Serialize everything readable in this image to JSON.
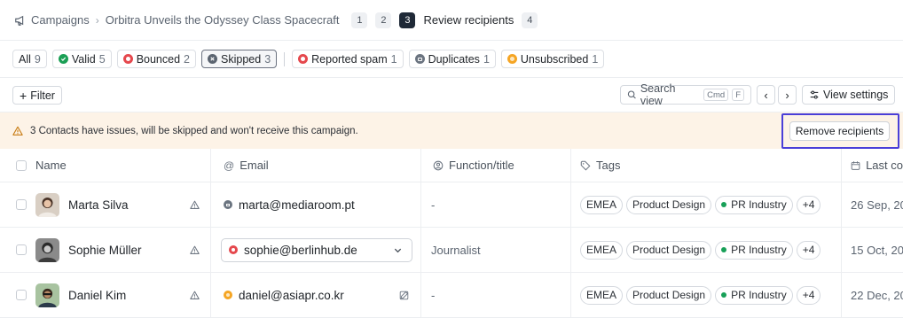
{
  "breadcrumb": {
    "campaigns": "Campaigns",
    "campaign_name": "Orbitra Unveils the Odyssey Class Spacecraft",
    "steps": [
      {
        "num": "1",
        "label": ""
      },
      {
        "num": "2",
        "label": ""
      },
      {
        "num": "3",
        "label": "Review recipients"
      },
      {
        "num": "4",
        "label": ""
      }
    ]
  },
  "filters": [
    {
      "label": "All",
      "count": "9",
      "icon": "none"
    },
    {
      "label": "Valid",
      "count": "5",
      "icon": "check-circle-icon",
      "color": "#1a9f55"
    },
    {
      "label": "Bounced",
      "count": "2",
      "icon": "bounce-icon",
      "color": "#e5484d"
    },
    {
      "label": "Skipped",
      "count": "3",
      "icon": "x-circle-icon",
      "color": "#5b6470"
    },
    {
      "label": "Reported spam",
      "count": "1",
      "icon": "spam-icon",
      "color": "#e5484d"
    },
    {
      "label": "Duplicates",
      "count": "1",
      "icon": "duplicate-icon",
      "color": "#6b7480"
    },
    {
      "label": "Unsubscribed",
      "count": "1",
      "icon": "unsubscribe-icon",
      "color": "#f5a524"
    }
  ],
  "toolbar": {
    "filter_label": "Filter",
    "search_placeholder": "Search view",
    "kbd_cmd": "Cmd",
    "kbd_f": "F",
    "view_settings": "View settings"
  },
  "banner": {
    "message": "3 Contacts have issues, will be skipped and won't receive this campaign.",
    "remove_label": "Remove recipients"
  },
  "table": {
    "headers": {
      "name": "Name",
      "email": "Email",
      "function": "Function/title",
      "tags": "Tags",
      "last": "Last co"
    },
    "rows": [
      {
        "name": "Marta Silva",
        "email": "marta@mediaroom.pt",
        "email_status": "duplicate",
        "function": "-",
        "tags": [
          "EMEA",
          "Product Design",
          "PR Industry"
        ],
        "more_tags": "+4",
        "last": "26 Sep, 20"
      },
      {
        "name": "Sophie Müller",
        "email": "sophie@berlinhub.de",
        "email_status": "bounced",
        "function": "Journalist",
        "tags": [
          "EMEA",
          "Product Design",
          "PR Industry"
        ],
        "more_tags": "+4",
        "last": "15 Oct, 20"
      },
      {
        "name": "Daniel Kim",
        "email": "daniel@asiapr.co.kr",
        "email_status": "unsubscribed",
        "function": "-",
        "tags": [
          "EMEA",
          "Product Design",
          "PR Industry"
        ],
        "more_tags": "+4",
        "last": "22 Dec, 20"
      }
    ]
  },
  "colors": {
    "accent_highlight": "#4a3fd8",
    "banner_bg": "#fdf3e7",
    "valid": "#1a9f55",
    "bounced": "#e5484d",
    "unsubscribed": "#f5a524"
  }
}
